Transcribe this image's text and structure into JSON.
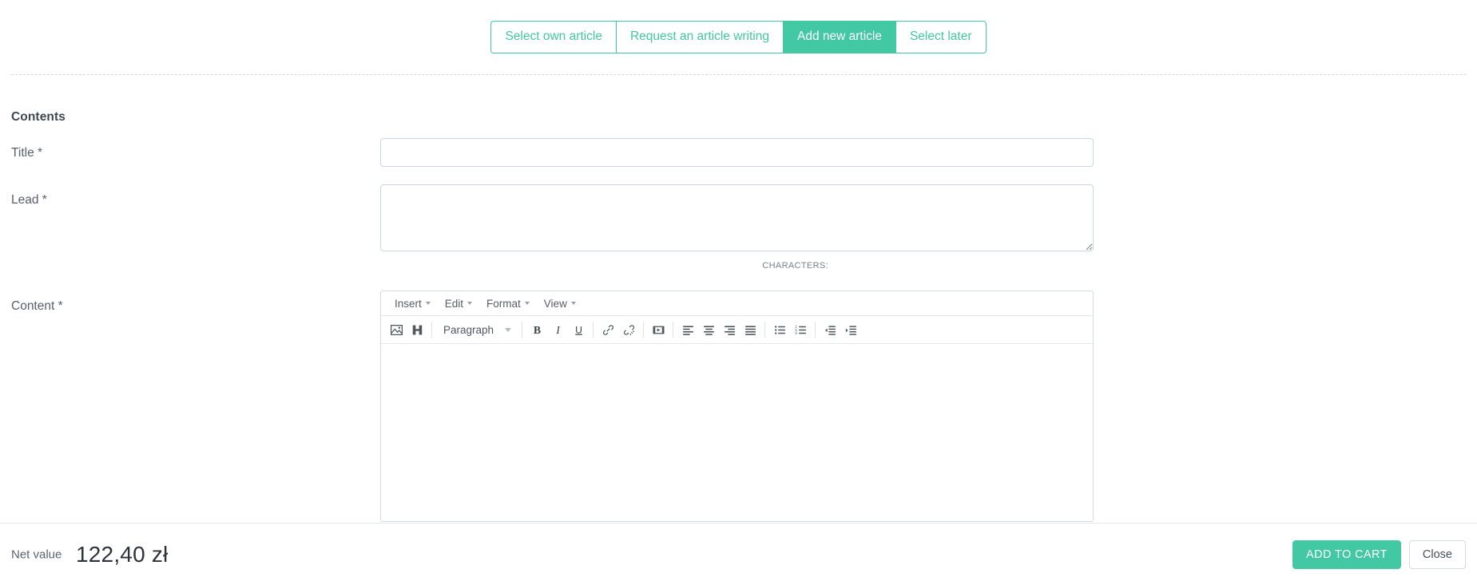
{
  "tabs": [
    {
      "label": "Select own article",
      "active": false
    },
    {
      "label": "Request an article writing",
      "active": false
    },
    {
      "label": "Add new article",
      "active": true
    },
    {
      "label": "Select later",
      "active": false
    }
  ],
  "form": {
    "heading": "Contents",
    "title": {
      "label": "Title *",
      "value": "",
      "placeholder": ""
    },
    "lead": {
      "label": "Lead *",
      "value": "",
      "placeholder": ""
    },
    "content": {
      "label": "Content *",
      "value": ""
    },
    "characters_label": "CHARACTERS:"
  },
  "editor": {
    "menus": [
      {
        "label": "Insert"
      },
      {
        "label": "Edit"
      },
      {
        "label": "Format"
      },
      {
        "label": "View"
      }
    ],
    "format_select": "Paragraph",
    "toolbar": [
      {
        "name": "insert-image-icon",
        "group": 0
      },
      {
        "name": "media-browse-icon",
        "group": 0
      },
      {
        "name": "format-select",
        "group": 1
      },
      {
        "name": "bold-icon",
        "group": 2
      },
      {
        "name": "italic-icon",
        "group": 2
      },
      {
        "name": "underline-icon",
        "group": 2
      },
      {
        "name": "link-icon",
        "group": 3
      },
      {
        "name": "unlink-icon",
        "group": 3
      },
      {
        "name": "insert-video-icon",
        "group": 4
      },
      {
        "name": "align-left-icon",
        "group": 5
      },
      {
        "name": "align-center-icon",
        "group": 5
      },
      {
        "name": "align-right-icon",
        "group": 5
      },
      {
        "name": "align-justify-icon",
        "group": 5
      },
      {
        "name": "bullet-list-icon",
        "group": 6
      },
      {
        "name": "numbered-list-icon",
        "group": 6
      },
      {
        "name": "outdent-icon",
        "group": 7
      },
      {
        "name": "indent-icon",
        "group": 7
      }
    ]
  },
  "footer": {
    "net_label": "Net value",
    "net_value": "122,40 zł",
    "add_to_cart": "ADD TO CART",
    "close": "Close"
  },
  "colors": {
    "accent": "#42c8a3",
    "text": "#3d4852",
    "border": "#ccd6e2"
  }
}
